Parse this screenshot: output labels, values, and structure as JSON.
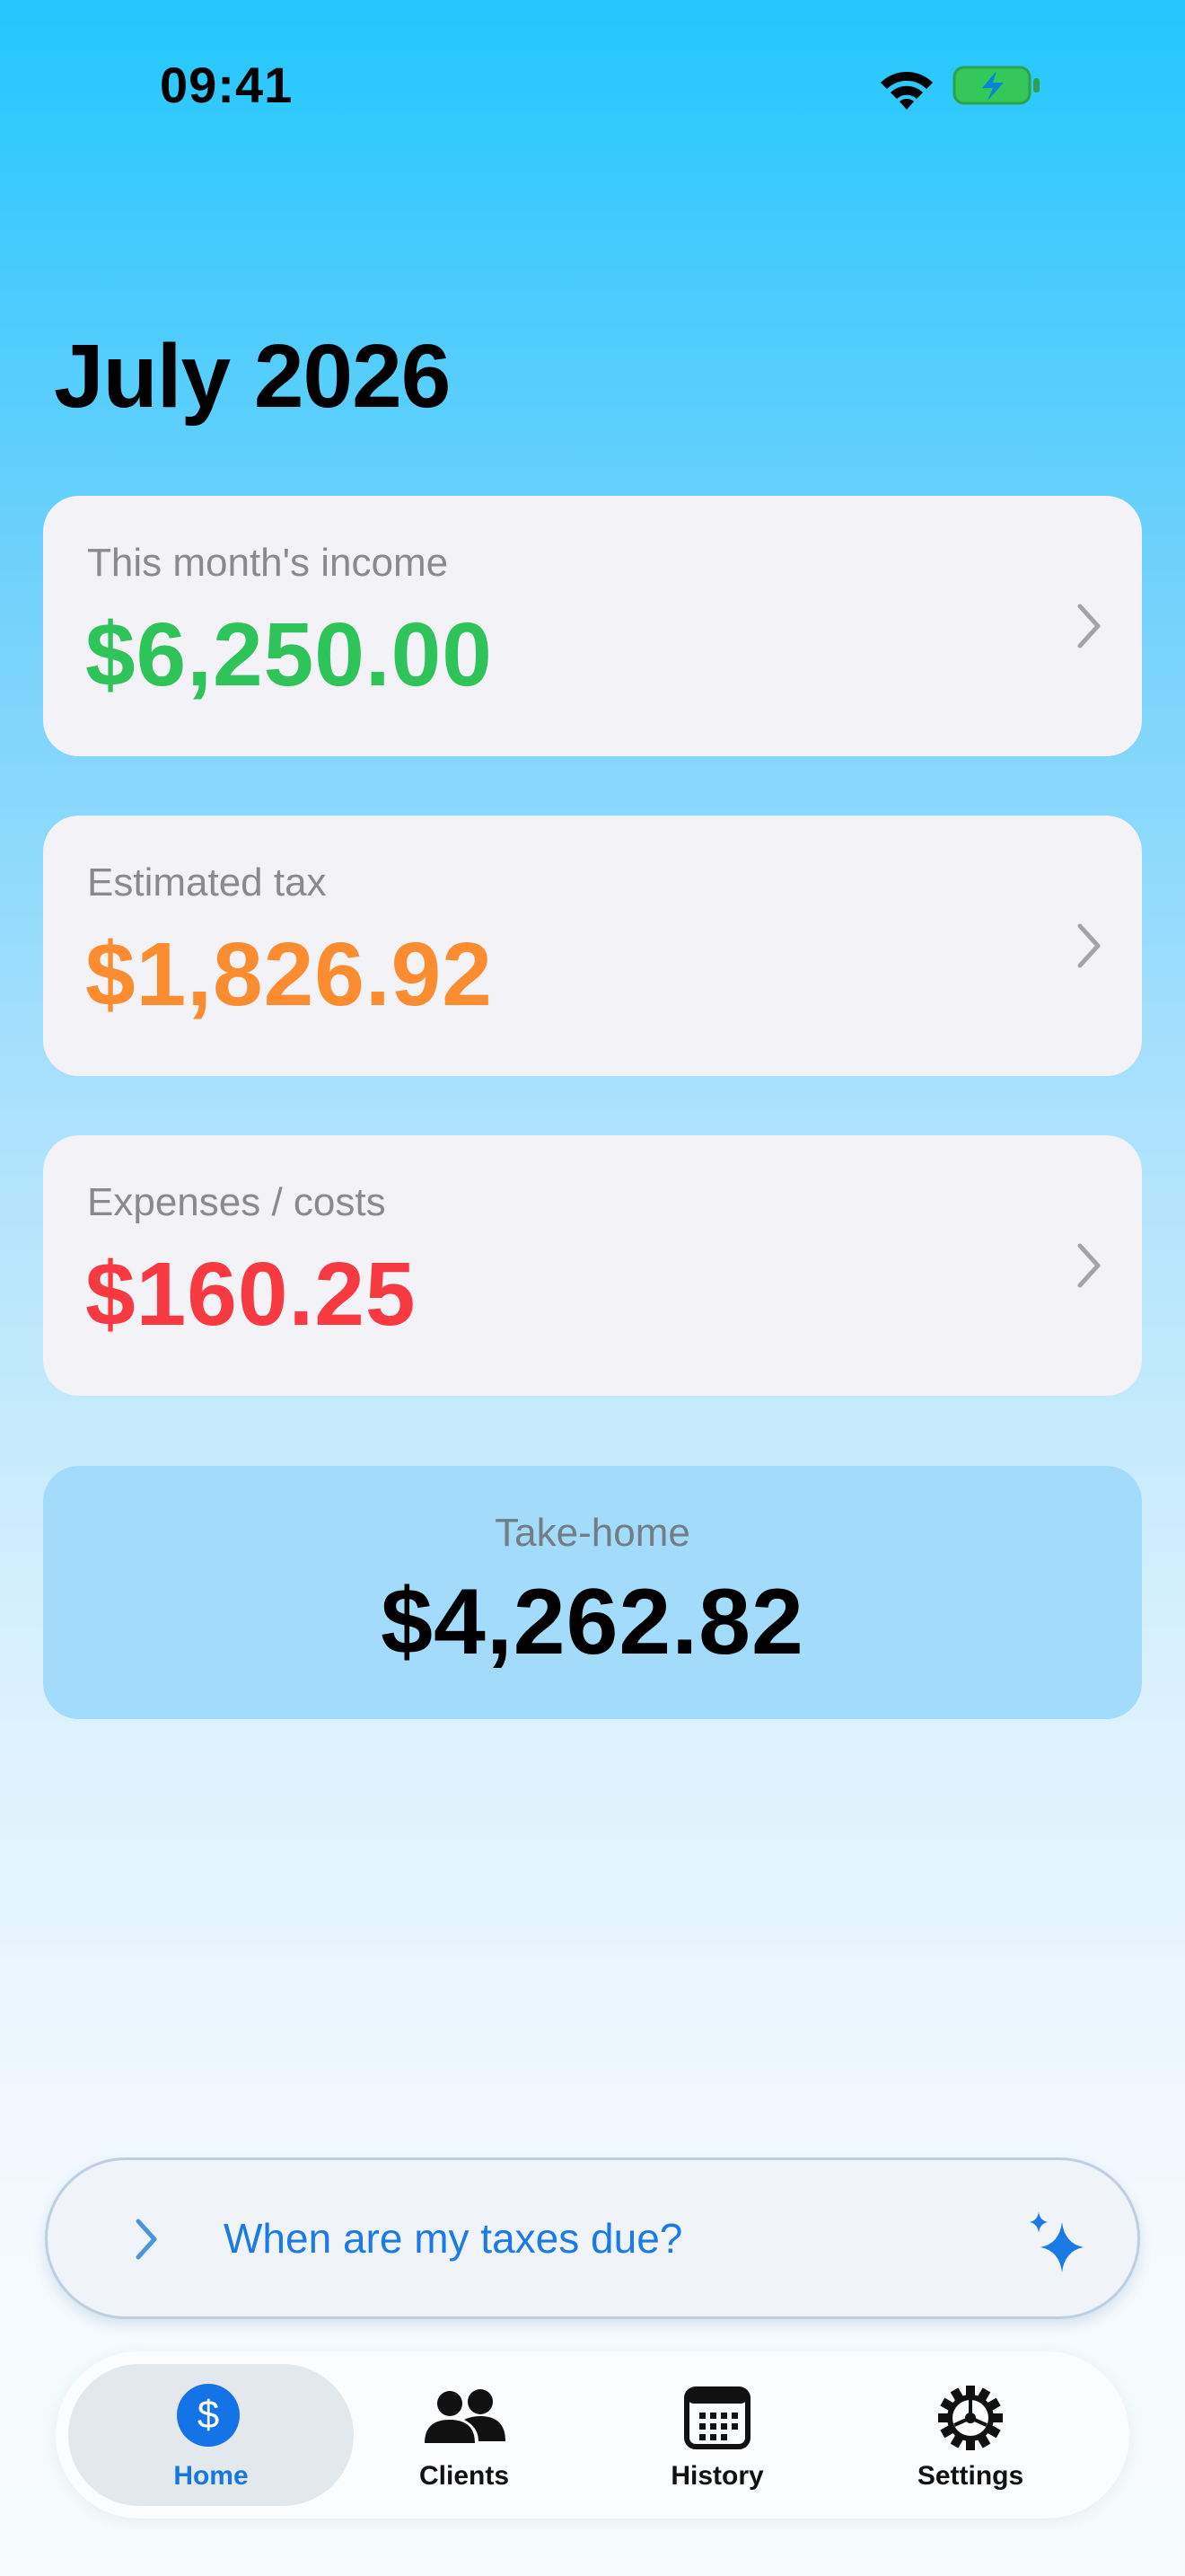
{
  "status_bar": {
    "time": "09:41"
  },
  "page": {
    "title": "July 2026"
  },
  "cards": [
    {
      "label": "This month's income",
      "value": "$6,250.00",
      "color": "#2fc45a"
    },
    {
      "label": "Estimated tax",
      "value": "$1,826.92",
      "color": "#fb8c2f"
    },
    {
      "label": "Expenses / costs",
      "value": "$160.25",
      "color": "#f73942"
    }
  ],
  "takehome": {
    "label": "Take-home",
    "value": "$4,262.82"
  },
  "ask": {
    "text": "When are my taxes due?"
  },
  "tabs": [
    {
      "label": "Home",
      "icon": "dollar-circle-icon",
      "active": true
    },
    {
      "label": "Clients",
      "icon": "people-icon",
      "active": false
    },
    {
      "label": "History",
      "icon": "calendar-icon",
      "active": false
    },
    {
      "label": "Settings",
      "icon": "gear-icon",
      "active": false
    }
  ],
  "colors": {
    "accent": "#1776e3"
  }
}
